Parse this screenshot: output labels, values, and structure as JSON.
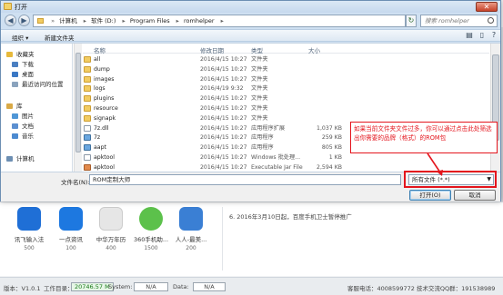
{
  "dialog": {
    "title": "打开",
    "close_label": "✕"
  },
  "address": {
    "crumbs": [
      "计算机",
      "软件 (D:)",
      "Program Files",
      "romhelper"
    ],
    "search_placeholder": "搜索 romhelper"
  },
  "toolbar": {
    "organize": "组织 ▾",
    "new_folder": "新建文件夹"
  },
  "nav": {
    "items": [
      {
        "label": "收藏夹",
        "color": "#e7b93b"
      },
      {
        "label": "下载",
        "color": "#4a7fc1"
      },
      {
        "label": "桌面",
        "color": "#3a78c4"
      },
      {
        "label": "最近访问的位置",
        "color": "#8aa3bd"
      },
      {
        "label": "库",
        "color": "#d9a946"
      },
      {
        "label": "图片",
        "color": "#4f96d6"
      },
      {
        "label": "文档",
        "color": "#5b8fd0"
      },
      {
        "label": "音乐",
        "color": "#4c8ad0"
      },
      {
        "label": "计算机",
        "color": "#6d8fb3"
      }
    ]
  },
  "columns": {
    "name": "名称",
    "date": "修改日期",
    "type": "类型",
    "size": "大小"
  },
  "files": [
    {
      "name": "all",
      "date": "2016/4/15 10:27",
      "type": "文件夹",
      "size": "",
      "icon": "folder"
    },
    {
      "name": "dump",
      "date": "2016/4/15 10:27",
      "type": "文件夹",
      "size": "",
      "icon": "folder"
    },
    {
      "name": "images",
      "date": "2016/4/15 10:27",
      "type": "文件夹",
      "size": "",
      "icon": "folder"
    },
    {
      "name": "logs",
      "date": "2016/4/19 9:32",
      "type": "文件夹",
      "size": "",
      "icon": "folder"
    },
    {
      "name": "plugins",
      "date": "2016/4/15 10:27",
      "type": "文件夹",
      "size": "",
      "icon": "folder"
    },
    {
      "name": "resource",
      "date": "2016/4/15 10:27",
      "type": "文件夹",
      "size": "",
      "icon": "folder"
    },
    {
      "name": "signapk",
      "date": "2016/4/15 10:27",
      "type": "文件夹",
      "size": "",
      "icon": "folder"
    },
    {
      "name": "7z.dll",
      "date": "2016/4/15 10:27",
      "type": "应用程序扩展",
      "size": "1,037 KB",
      "icon": "file"
    },
    {
      "name": "7z",
      "date": "2016/4/15 10:27",
      "type": "应用程序",
      "size": "259 KB",
      "icon": "exe"
    },
    {
      "name": "aapt",
      "date": "2016/4/15 10:27",
      "type": "应用程序",
      "size": "805 KB",
      "icon": "exe"
    },
    {
      "name": "apktool",
      "date": "2016/4/15 10:27",
      "type": "Windows 批处理...",
      "size": "1 KB",
      "icon": "file"
    },
    {
      "name": "apktool",
      "date": "2016/4/15 10:27",
      "type": "Executable Jar File",
      "size": "2,594 KB",
      "icon": "jar"
    }
  ],
  "bottom": {
    "filename_label": "文件名(N):",
    "filename_value": "ROM定制大师",
    "filter_value": "所有文件 (*.*)",
    "open_label": "打开(O)",
    "cancel_label": "取消"
  },
  "annotation": {
    "text": "如果当前文件夹文件过多，你可以通过点击此处筛选出你需要的品牌（格式）的ROM包"
  },
  "background_app": {
    "tiles": [
      {
        "name": "讯飞输入法",
        "count": "500",
        "color": "#1f6fd6"
      },
      {
        "name": "一点资讯",
        "count": "100",
        "color": "#1d78e0"
      },
      {
        "name": "中华万年历",
        "count": "400",
        "color": "#e6e6e6"
      },
      {
        "name": "360手机助...",
        "count": "1500",
        "color": "#5cc14b"
      },
      {
        "name": "人人-最美...",
        "count": "200",
        "color": "#3a7fd4"
      }
    ],
    "note": "6. 2016年3月10日起，百度手机卫士暂停推广"
  },
  "status": {
    "version_label": "版本：V1.0.1",
    "workspace_label": "工作目录：",
    "workspace_value": "20746.57 M",
    "system_label": "System:",
    "system_value": "N/A",
    "data_label": "Data:",
    "data_value": "N/A",
    "contact": "客服电话：4008599772  技术交流QQ群：191538989"
  }
}
